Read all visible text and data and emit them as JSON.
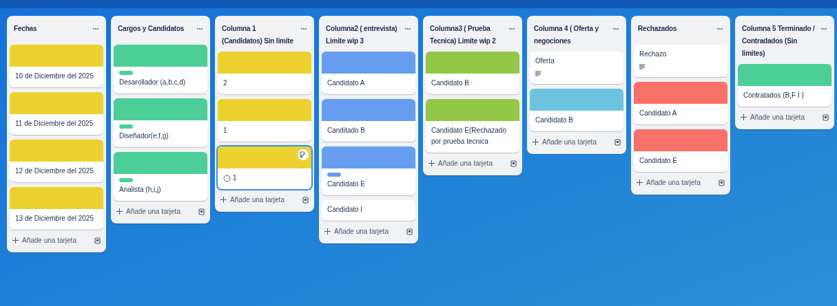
{
  "lists": [
    {
      "title": "Fechas",
      "add_label": "Añade una tarjeta",
      "cards": [
        {
          "color": "#ecd12e",
          "title": "10 de Diciembre del 2025"
        },
        {
          "color": "#ecd12e",
          "title": "11 de Diciembre del 2025"
        },
        {
          "color": "#ecd12e",
          "title": "12 de Diciembre del 2025"
        },
        {
          "color": "#ecd12e",
          "title": "13 de Diciembre del 2025"
        }
      ]
    },
    {
      "title": "Cargos y Candidatos",
      "add_label": "Añade una tarjeta",
      "cards": [
        {
          "color": "#4bce97",
          "label": {
            "color": "#4bce97"
          },
          "title": "Desarollador (a,b,c,d)"
        },
        {
          "color": "#4bce97",
          "label": {
            "color": "#4bce97"
          },
          "title": "Diseñador(e,f,g)"
        },
        {
          "color": "#4bce97",
          "label": {
            "color": "#4bce97"
          },
          "title": "Analista (h,i,j)"
        }
      ]
    },
    {
      "title": "Columna 1 (Candidatos) Sin limite",
      "add_label": "Añade una tarjeta",
      "cards": [
        {
          "color": "#ecd12e",
          "title": "2"
        },
        {
          "color": "#ecd12e",
          "title": "1"
        },
        {
          "color": "#ecd12e",
          "title": "1",
          "selected": true,
          "done": false
        }
      ]
    },
    {
      "title": "Columna2 ( entrevista) Limite wip 3",
      "add_label": "Añade una tarjeta",
      "cards": [
        {
          "color": "#669df1",
          "title": "Candidato A"
        },
        {
          "color": "#669df1",
          "title": "Canditado B"
        },
        {
          "color": "#669df1",
          "label": {
            "color": "#669df1"
          },
          "title": "Candidato E"
        },
        {
          "title": "Candidato I"
        }
      ]
    },
    {
      "title": "Columna3 ( Prueba Tecnica) Limite wip 2",
      "add_label": "Añade una tarjeta",
      "cards": [
        {
          "color": "#94c748",
          "title": "Candidato B"
        },
        {
          "color": "#94c748",
          "title": "Candidato E(Rechazado por prueba tecnica"
        }
      ]
    },
    {
      "title": "Columna 4 ( Oferta y negociones",
      "add_label": "Añade una tarjeta",
      "cards": [
        {
          "title": "Oferta",
          "description": true
        },
        {
          "color": "#6cc3e0",
          "title": "Candidato B"
        }
      ]
    },
    {
      "title": "Rechazados",
      "add_label": "Añade una tarjeta",
      "cards": [
        {
          "title": "Rechazo",
          "description": true
        },
        {
          "color": "#f87168",
          "title": "Candidato A"
        },
        {
          "color": "#f87168",
          "title": "Candidato E"
        }
      ]
    },
    {
      "title": "Columna 5 Terminado / Contradados (Sin limites)",
      "add_label": "Añade una tarjeta",
      "cards": [
        {
          "color": "#4bce97",
          "title": "Contratados (B,F I )"
        }
      ]
    }
  ]
}
